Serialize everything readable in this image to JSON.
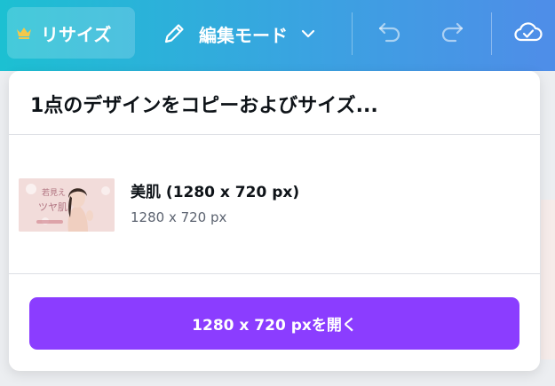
{
  "toolbar": {
    "resize_label": "リサイズ",
    "edit_mode_label": "編集モード",
    "icons": [
      "crown-icon",
      "pencil-icon",
      "chevron-down-icon",
      "undo-icon",
      "redo-icon",
      "cloud-saved-icon"
    ]
  },
  "panel": {
    "title": "1点のデザインをコピーおよびサイズ...",
    "design": {
      "name": "美肌 (1280 x 720 px)",
      "size": "1280 x 720 px",
      "thumbnail_text": [
        "若見え",
        "ツヤ肌"
      ]
    },
    "open_button_label": "1280 x 720 pxを開く"
  },
  "colors": {
    "toolbar_start": "#1cc0d2",
    "toolbar_end": "#4f8de8",
    "primary_button": "#8b3dff",
    "text_primary": "#0e1318",
    "text_secondary": "#5c6370"
  }
}
